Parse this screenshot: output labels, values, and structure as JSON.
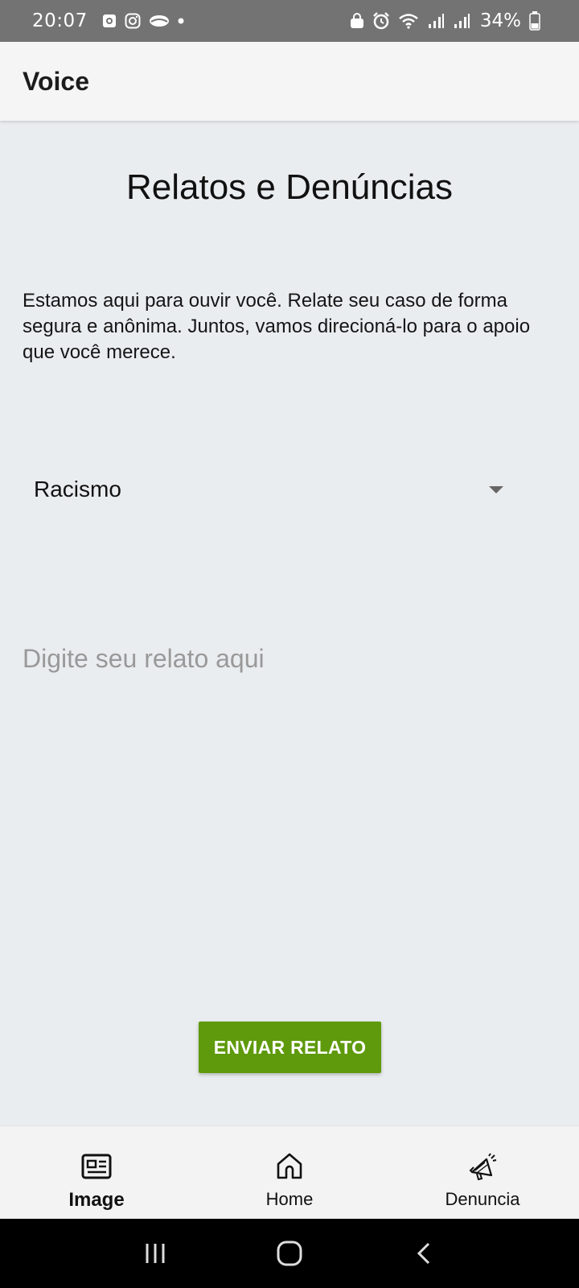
{
  "status_bar": {
    "time": "20:07",
    "battery": "34%",
    "icons": [
      "notification-app-icon",
      "instagram-icon",
      "cloud-icon",
      "dot-icon",
      "lock-icon",
      "alarm-icon",
      "wifi-icon",
      "signal-icon",
      "signal-icon",
      "battery-icon"
    ]
  },
  "app_bar": {
    "title": "Voice"
  },
  "main": {
    "title": "Relatos e Denúncias",
    "intro": "Estamos aqui para ouvir você. Relate seu caso de forma segura e anônima. Juntos, vamos direcioná-lo para o apoio que você merece.",
    "category_select": {
      "value": "Racismo"
    },
    "report_input": {
      "value": "",
      "placeholder": "Digite seu relato aqui"
    },
    "submit_label": "ENVIAR RELATO"
  },
  "bottom_nav": {
    "items": [
      {
        "label": "Image",
        "icon": "newspaper-icon",
        "active": true
      },
      {
        "label": "Home",
        "icon": "home-icon",
        "active": false
      },
      {
        "label": "Denuncia",
        "icon": "megaphone-icon",
        "active": false
      }
    ]
  },
  "system_nav": [
    "recent-apps-icon",
    "home-icon",
    "back-icon"
  ],
  "colors": {
    "background": "#eaedf0",
    "app_bar": "#f5f5f5",
    "status_bar": "#737373",
    "accent_button": "#5e9a0b",
    "placeholder": "#999999"
  }
}
